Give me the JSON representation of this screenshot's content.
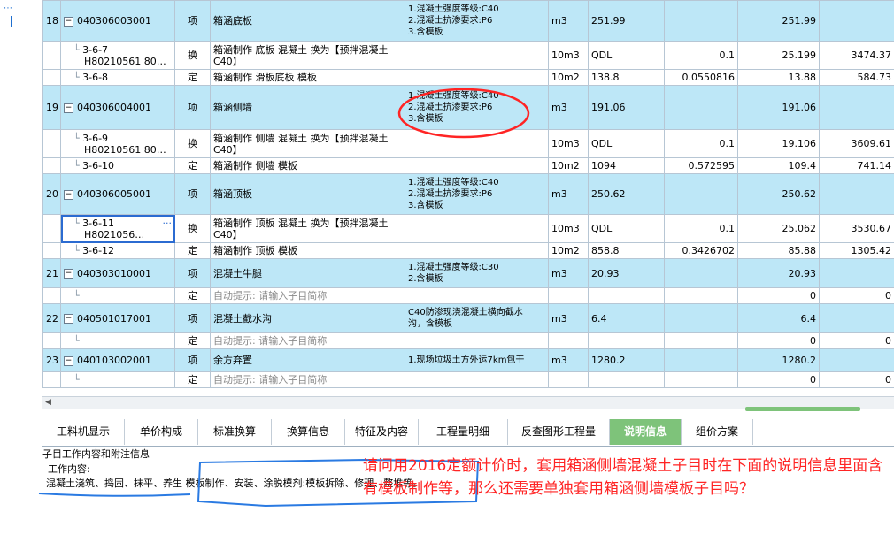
{
  "rows": [
    {
      "type": "item",
      "no": "18",
      "code": "040306003001",
      "kind": "项",
      "name": "箱涵底板",
      "desc": [
        "1.混凝土强度等级:C40",
        "2.混凝土抗渗要求:P6",
        "3.含模板"
      ],
      "unit": "m3",
      "qty": "251.99",
      "coef": "",
      "total": "251.99",
      "price": ""
    },
    {
      "type": "sub",
      "code": "3-6-7",
      "code2": "H80210561 80…",
      "kind": "换",
      "name": "箱涵制作 底板 混凝土  换为【预拌混凝土 C40】",
      "desc": [],
      "unit": "10m3",
      "qty": "QDL",
      "coef": "0.1",
      "total": "25.199",
      "price": "3474.37"
    },
    {
      "type": "sub",
      "code": "3-6-8",
      "code2": "",
      "kind": "定",
      "name": "箱涵制作 滑板底板 模板",
      "desc": [],
      "unit": "10m2",
      "qty": "138.8",
      "coef": "0.0550816",
      "total": "13.88",
      "price": "584.73"
    },
    {
      "type": "item",
      "no": "19",
      "code": "040306004001",
      "kind": "项",
      "name": "箱涵侧墙",
      "desc": [
        "1.混凝土强度等级:C40",
        "2.混凝土抗渗要求:P6",
        "3.含模板"
      ],
      "unit": "m3",
      "qty": "191.06",
      "coef": "",
      "total": "191.06",
      "price": ""
    },
    {
      "type": "sub",
      "code": "3-6-9",
      "code2": "H80210561 80…",
      "kind": "换",
      "name": "箱涵制作 侧墙 混凝土  换为【预拌混凝土 C40】",
      "desc": [],
      "unit": "10m3",
      "qty": "QDL",
      "coef": "0.1",
      "total": "19.106",
      "price": "3609.61"
    },
    {
      "type": "sub",
      "code": "3-6-10",
      "code2": "",
      "kind": "定",
      "name": "箱涵制作 侧墙 模板",
      "desc": [],
      "unit": "10m2",
      "qty": "1094",
      "coef": "0.572595",
      "total": "109.4",
      "price": "741.14"
    },
    {
      "type": "item",
      "no": "20",
      "code": "040306005001",
      "kind": "项",
      "name": "箱涵顶板",
      "desc": [
        "1.混凝土强度等级:C40",
        "2.混凝土抗渗要求:P6",
        "3.含模板"
      ],
      "unit": "m3",
      "qty": "250.62",
      "coef": "",
      "total": "250.62",
      "price": ""
    },
    {
      "type": "sub",
      "code": "3-6-11",
      "code2": "H8021056…",
      "kind": "换",
      "name": "箱涵制作 顶板 混凝土  换为【预拌混凝土 C40】",
      "desc": [],
      "unit": "10m3",
      "qty": "QDL",
      "coef": "0.1",
      "total": "25.062",
      "price": "3530.67",
      "selected": true
    },
    {
      "type": "sub",
      "code": "3-6-12",
      "code2": "",
      "kind": "定",
      "name": "箱涵制作 顶板 模板",
      "desc": [],
      "unit": "10m2",
      "qty": "858.8",
      "coef": "0.3426702",
      "total": "85.88",
      "price": "1305.42"
    },
    {
      "type": "item",
      "no": "21",
      "code": "040303010001",
      "kind": "项",
      "name": "混凝土牛腿",
      "desc": [
        "1.混凝土强度等级:C30",
        "2.含模板"
      ],
      "unit": "m3",
      "qty": "20.93",
      "coef": "",
      "total": "20.93",
      "price": ""
    },
    {
      "type": "sub",
      "code": "",
      "code2": "",
      "kind": "定",
      "name": "自动提示: 请输入子目简称",
      "hint": true,
      "desc": [],
      "unit": "",
      "qty": "",
      "coef": "",
      "total": "0",
      "price": "0"
    },
    {
      "type": "item",
      "no": "22",
      "code": "040501017001",
      "kind": "项",
      "name": "混凝土截水沟",
      "desc": [
        "C40防渗现浇混凝土横向截水",
        "沟，含模板"
      ],
      "unit": "m3",
      "qty": "6.4",
      "coef": "",
      "total": "6.4",
      "price": ""
    },
    {
      "type": "sub",
      "code": "",
      "code2": "",
      "kind": "定",
      "name": "自动提示: 请输入子目简称",
      "hint": true,
      "desc": [],
      "unit": "",
      "qty": "",
      "coef": "",
      "total": "0",
      "price": "0"
    },
    {
      "type": "item",
      "no": "23",
      "code": "040103002001",
      "kind": "项",
      "name": "余方弃置",
      "desc": [
        "1.现场垃圾土方外运7km包干"
      ],
      "unit": "m3",
      "qty": "1280.2",
      "coef": "",
      "total": "1280.2",
      "price": ""
    },
    {
      "type": "sub",
      "code": "",
      "code2": "",
      "kind": "定",
      "name": "自动提示: 请输入子目简称",
      "hint": true,
      "desc": [],
      "unit": "",
      "qty": "",
      "coef": "",
      "total": "0",
      "price": "0"
    }
  ],
  "tabs": [
    "工料机显示",
    "单价构成",
    "标准换算",
    "换算信息",
    "特征及内容",
    "工程量明细",
    "反查图形工程量",
    "说明信息",
    "组价方案"
  ],
  "active_tab": "说明信息",
  "panel": {
    "header": "子目工作内容和附注信息",
    "content_label": "工作内容:",
    "content_text": "混凝土浇筑、捣固、抹平、养生 模板制作、安装、涂脱模剂:模板拆除、修理、整堆等。"
  },
  "question": "请问用2016定额计价时，套用箱涵侧墙混凝土子目时在下面的说明信息里面含有模板制作等，那么还需要单独套用箱涵侧墙模板子目吗？",
  "colors": {
    "item_row": "#bde7f7",
    "active_tab": "#7ec37a",
    "annotation": "#ff2424",
    "underline": "#2a7ae2"
  }
}
